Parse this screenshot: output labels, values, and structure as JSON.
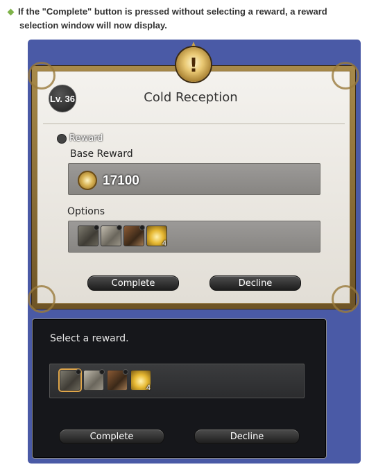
{
  "note": {
    "line1": "If the \"Complete\" button is pressed without selecting a reward, a reward",
    "line2": "selection window will now display."
  },
  "colors": {
    "page_background": "#ffffff",
    "panel_blue": "#4a5aa6",
    "note_bullet": "#7fb34a",
    "selected_border": "#e0a64a"
  },
  "quest_window": {
    "crest_icon": "exclamation-crest-icon",
    "crest_symbol": "!",
    "level_badge": "Lv. 36",
    "title": "Cold Reception",
    "reward_header": "Reward",
    "base_reward_label": "Base Reward",
    "gil_icon": "gil-coin-icon",
    "gil_amount": "17100",
    "options_label": "Options",
    "options": [
      {
        "icon": "armor-icon",
        "quantity": ""
      },
      {
        "icon": "robe-icon",
        "quantity": ""
      },
      {
        "icon": "vest-icon",
        "quantity": ""
      },
      {
        "icon": "orb-icon",
        "quantity": "4"
      }
    ],
    "complete_button": "Complete",
    "decline_button": "Decline"
  },
  "select_window": {
    "title": "Select a reward.",
    "items": [
      {
        "icon": "armor-icon",
        "quantity": "",
        "selected": true
      },
      {
        "icon": "robe-icon",
        "quantity": "",
        "selected": false
      },
      {
        "icon": "vest-icon",
        "quantity": "",
        "selected": false
      },
      {
        "icon": "orb-icon",
        "quantity": "4",
        "selected": false
      }
    ],
    "complete_button": "Complete",
    "decline_button": "Decline"
  }
}
